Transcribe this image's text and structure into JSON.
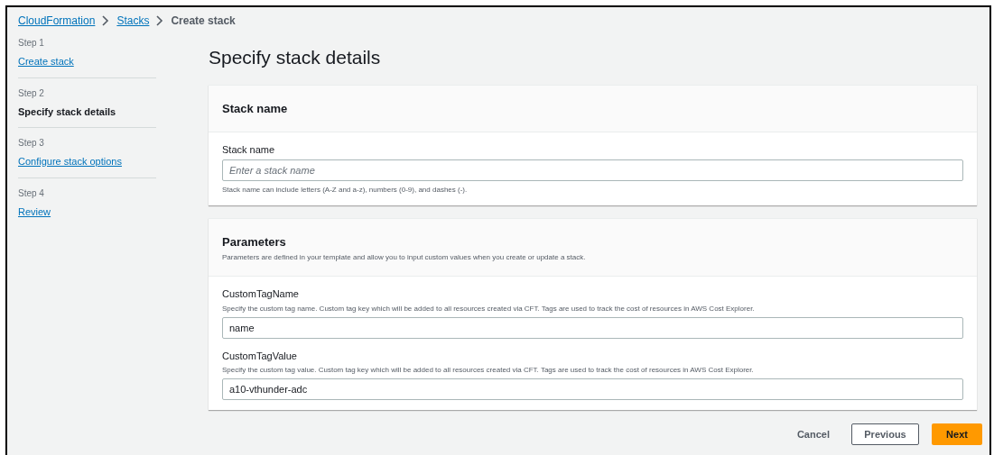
{
  "breadcrumb": [
    {
      "label": "CloudFormation",
      "kind": "link"
    },
    {
      "label": "Stacks",
      "kind": "link"
    },
    {
      "label": "Create stack",
      "kind": "current"
    }
  ],
  "steps": [
    {
      "step": "Step 1",
      "label": "Create stack",
      "selected": false
    },
    {
      "step": "Step 2",
      "label": "Specify stack details",
      "selected": true
    },
    {
      "step": "Step 3",
      "label": "Configure stack options",
      "selected": false
    },
    {
      "step": "Step 4",
      "label": "Review",
      "selected": false
    }
  ],
  "title": "Specify stack details",
  "sections": [
    {
      "heading": "Stack name",
      "fields": [
        {
          "label": "Stack name",
          "placeholder": "Enter a stack name",
          "hint": "Stack name can include letters (A-Z and a-z), numbers (0-9), and dashes (-)."
        }
      ]
    },
    {
      "heading": "Parameters",
      "description": "Parameters are defined in your template and allow you to input custom values when you create or update a stack.",
      "fields": [
        {
          "label": "CustomTagName",
          "description": "Specify the custom tag name. Custom tag key which will be added to all resources created via CFT. Tags are used to track the cost of resources in AWS Cost Explorer.",
          "value": "name"
        },
        {
          "label": "CustomTagValue",
          "description": "Specify the custom tag value. Custom tag key which will be added to all resources created via CFT. Tags are used to track the cost of resources in AWS Cost Explorer.",
          "value": "a10-vthunder-adc"
        }
      ]
    }
  ],
  "buttons": [
    {
      "label": "Cancel",
      "kind": "link"
    },
    {
      "label": "Previous",
      "kind": "normal"
    },
    {
      "label": "Next",
      "kind": "primary"
    }
  ]
}
